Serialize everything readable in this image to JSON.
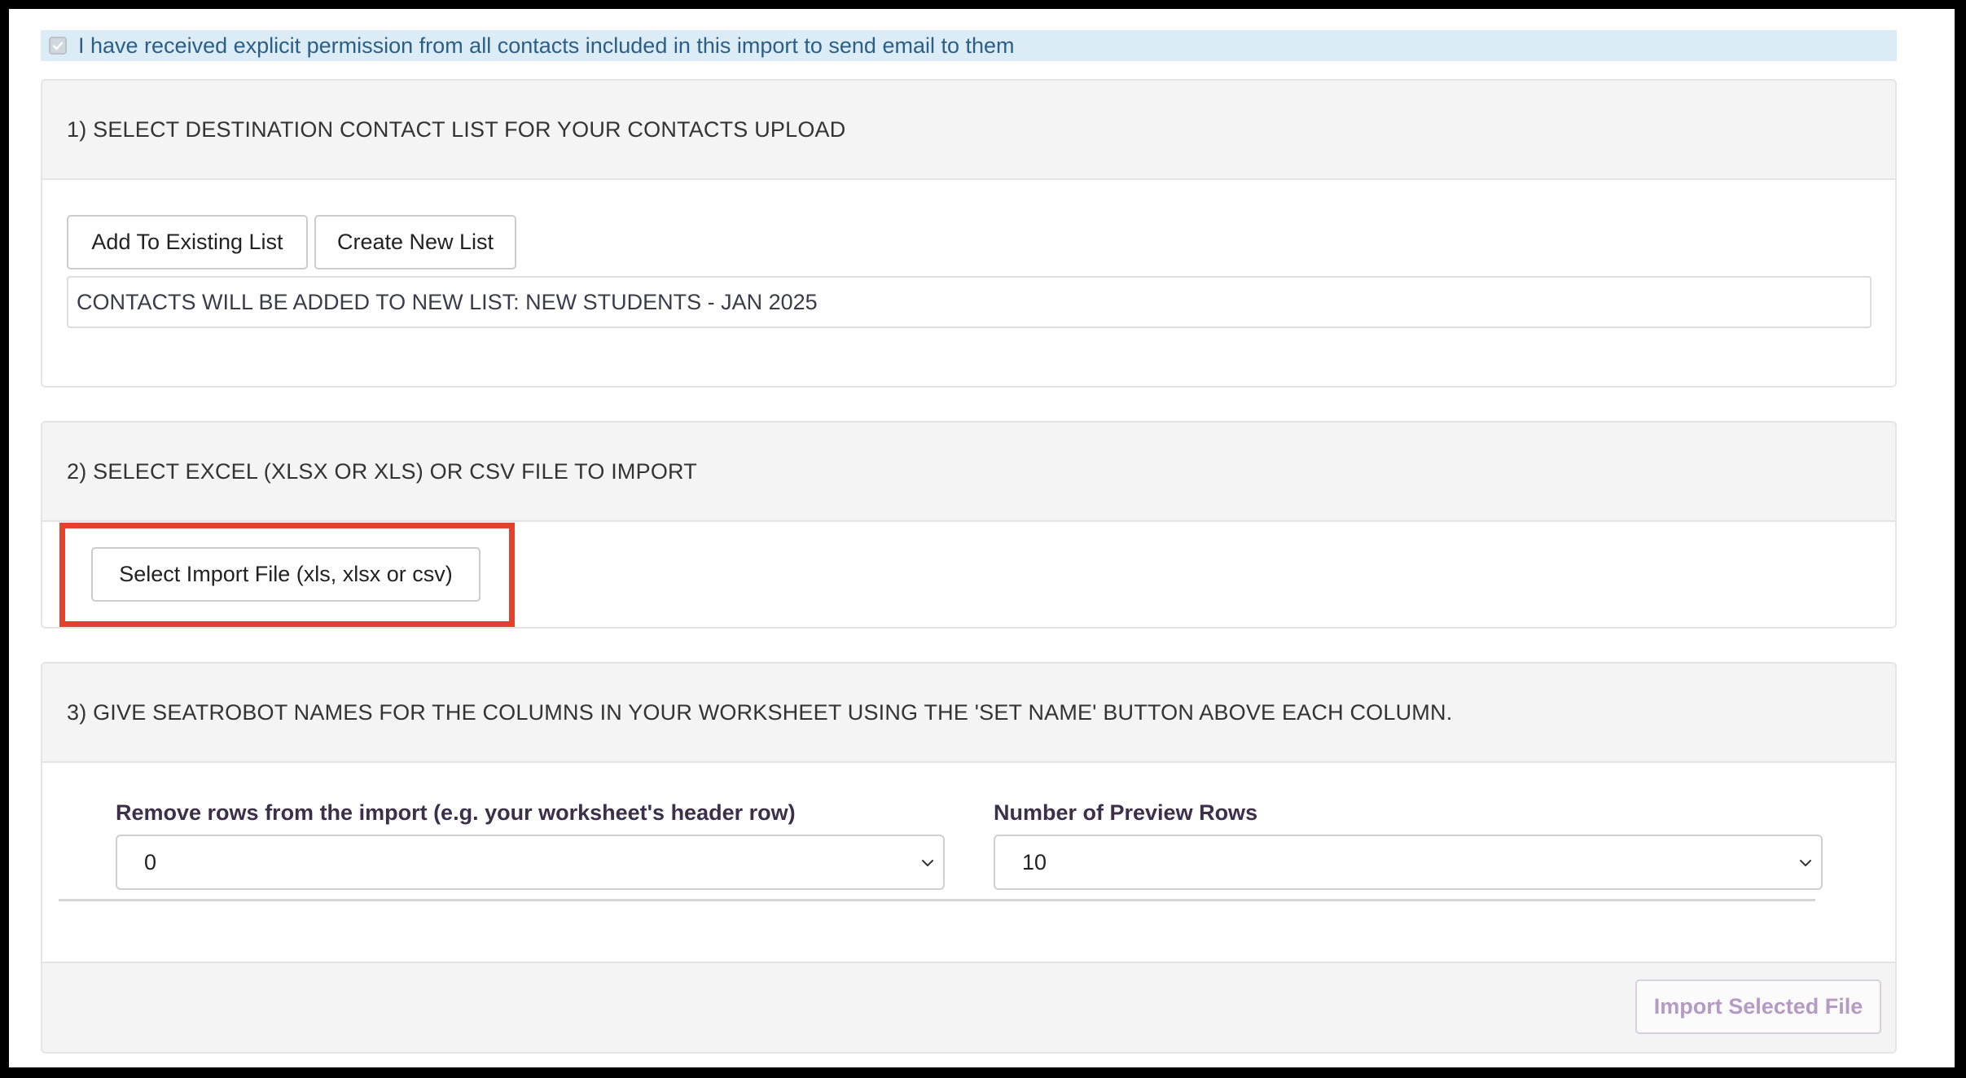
{
  "consent": {
    "checked": true,
    "text": "I have received explicit permission from all contacts included in this import to send email to them"
  },
  "step1": {
    "title": "1) SELECT DESTINATION CONTACT LIST FOR YOUR CONTACTS UPLOAD",
    "add_existing_label": "Add To Existing List",
    "create_new_label": "Create New List",
    "status_text": "CONTACTS WILL BE ADDED TO NEW LIST: NEW STUDENTS - JAN 2025"
  },
  "step2": {
    "title": "2) SELECT EXCEL (XLSX OR XLS) OR CSV FILE TO IMPORT",
    "select_file_label": "Select Import File (xls, xlsx or csv)"
  },
  "step3": {
    "title": "3) GIVE SEATROBOT NAMES FOR THE COLUMNS IN YOUR WORKSHEET USING THE 'SET NAME' BUTTON ABOVE EACH COLUMN.",
    "remove_rows_label": "Remove rows from the import (e.g. your worksheet's header row)",
    "remove_rows_value": "0",
    "preview_rows_label": "Number of Preview Rows",
    "preview_rows_value": "10",
    "import_button_label": "Import Selected File"
  },
  "colors": {
    "consent_bg": "#dcecf7",
    "consent_text": "#2b5f86",
    "highlight": "#e5402b",
    "disabled_button_text": "#b39bc3"
  }
}
